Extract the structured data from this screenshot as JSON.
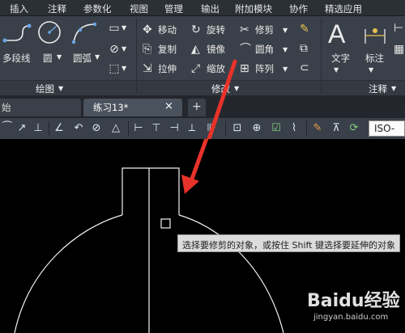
{
  "menubar": {
    "tabs": [
      "插入",
      "注释",
      "参数化",
      "视图",
      "管理",
      "输出",
      "附加模块",
      "协作",
      "精选应用"
    ]
  },
  "ribbon": {
    "draw": {
      "polyline": "多段线",
      "circle": "圆",
      "arc": "圆弧",
      "title": "绘图"
    },
    "modify": {
      "move": "移动",
      "rotate": "旋转",
      "trim": "修剪",
      "copy": "复制",
      "mirror": "镜像",
      "fillet": "圆角",
      "stretch": "拉伸",
      "scale": "缩放",
      "array": "阵列",
      "title": "修改"
    },
    "annotation": {
      "text": "文字",
      "dimension": "标注",
      "title": "注释"
    }
  },
  "doctabs": {
    "start": "始",
    "current": "练习13*",
    "close": "×",
    "add": "+"
  },
  "toolbar": {
    "style": "ISO-"
  },
  "canvas": {
    "tooltip": "选择要修剪的对象，或按住 Shift 键选择要延伸的对象"
  },
  "watermark": {
    "brand": "Baidu经验",
    "url": "jingyan.baidu.com"
  },
  "colors": {
    "annotation_arrow": "#e8322a",
    "ribbon_bg": "#3a4049",
    "canvas_bg": "#000000"
  }
}
